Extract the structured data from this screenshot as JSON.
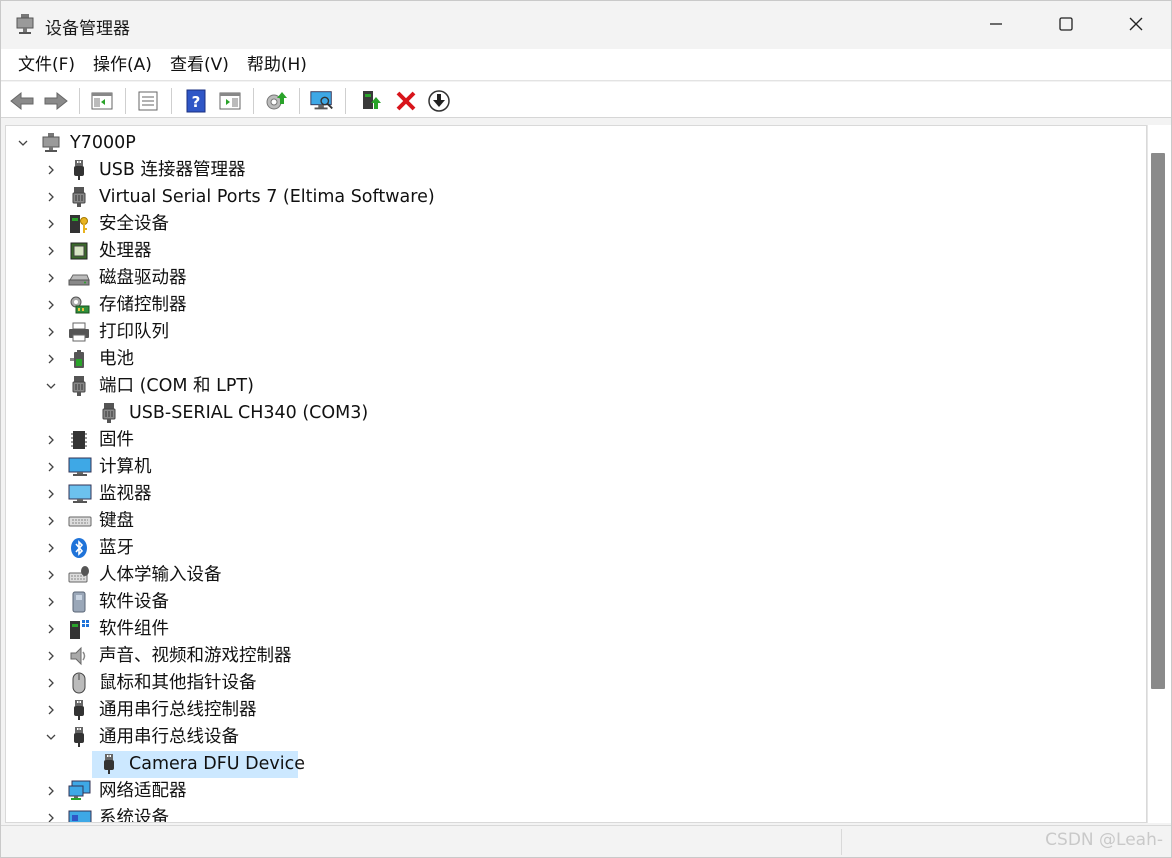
{
  "window": {
    "title": "设备管理器"
  },
  "menu": [
    "文件(F)",
    "操作(A)",
    "查看(V)",
    "帮助(H)"
  ],
  "toolbar": {
    "buttons": [
      "back-arrow-icon",
      "forward-arrow-icon",
      "show-hide-console-tree-icon",
      "properties-icon",
      "help-icon",
      "show-action-pane-icon",
      "update-driver-icon",
      "scan-hardware-icon",
      "enable-device-icon",
      "uninstall-device-icon",
      "disable-device-icon"
    ]
  },
  "tree": {
    "root": "Y7000P",
    "items": [
      {
        "label": "USB 连接器管理器",
        "icon": "usb-connector-icon",
        "expanded": false,
        "level": 1
      },
      {
        "label": "Virtual Serial Ports 7 (Eltima Software)",
        "icon": "port-icon",
        "expanded": false,
        "level": 1
      },
      {
        "label": "安全设备",
        "icon": "security-device-icon",
        "expanded": false,
        "level": 1
      },
      {
        "label": "处理器",
        "icon": "processor-icon",
        "expanded": false,
        "level": 1
      },
      {
        "label": "磁盘驱动器",
        "icon": "disk-drive-icon",
        "expanded": false,
        "level": 1
      },
      {
        "label": "存储控制器",
        "icon": "storage-controller-icon",
        "expanded": false,
        "level": 1
      },
      {
        "label": "打印队列",
        "icon": "printer-icon",
        "expanded": false,
        "level": 1
      },
      {
        "label": "电池",
        "icon": "battery-icon",
        "expanded": false,
        "level": 1
      },
      {
        "label": "端口 (COM 和 LPT)",
        "icon": "port-icon",
        "expanded": true,
        "level": 1
      },
      {
        "label": "USB-SERIAL CH340 (COM3)",
        "icon": "port-icon",
        "level": 2
      },
      {
        "label": "固件",
        "icon": "firmware-icon",
        "expanded": false,
        "level": 1
      },
      {
        "label": "计算机",
        "icon": "computer-icon",
        "expanded": false,
        "level": 1
      },
      {
        "label": "监视器",
        "icon": "monitor-icon",
        "expanded": false,
        "level": 1
      },
      {
        "label": "键盘",
        "icon": "keyboard-icon",
        "expanded": false,
        "level": 1
      },
      {
        "label": "蓝牙",
        "icon": "bluetooth-icon",
        "expanded": false,
        "level": 1
      },
      {
        "label": "人体学输入设备",
        "icon": "hid-icon",
        "expanded": false,
        "level": 1
      },
      {
        "label": "软件设备",
        "icon": "software-device-icon",
        "expanded": false,
        "level": 1
      },
      {
        "label": "软件组件",
        "icon": "software-component-icon",
        "expanded": false,
        "level": 1
      },
      {
        "label": "声音、视频和游戏控制器",
        "icon": "speaker-icon",
        "expanded": false,
        "level": 1
      },
      {
        "label": "鼠标和其他指针设备",
        "icon": "mouse-icon",
        "expanded": false,
        "level": 1
      },
      {
        "label": "通用串行总线控制器",
        "icon": "usb-icon",
        "expanded": false,
        "level": 1
      },
      {
        "label": "通用串行总线设备",
        "icon": "usb-icon",
        "expanded": true,
        "level": 1
      },
      {
        "label": "Camera DFU Device",
        "icon": "usb-icon",
        "level": 2,
        "selected": true
      },
      {
        "label": "网络适配器",
        "icon": "network-adapter-icon",
        "expanded": false,
        "level": 1
      },
      {
        "label": "系统设备",
        "icon": "system-device-icon",
        "expanded": false,
        "level": 1
      }
    ]
  },
  "watermark": "CSDN @Leah-",
  "colors": {
    "selection": "#cce8ff",
    "delete_red": "#d8141b",
    "accent_green": "#2aa32a"
  }
}
